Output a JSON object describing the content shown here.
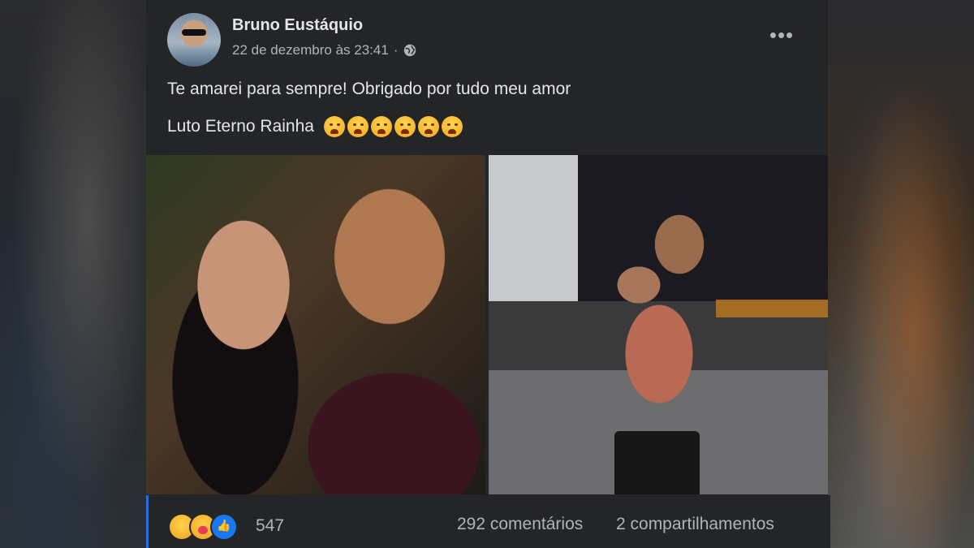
{
  "post": {
    "author": "Bruno Eustáquio",
    "timestamp": "22 de dezembro às 23:41",
    "separator": "·",
    "privacy_icon": "globe-icon",
    "more_label": "•••",
    "text_line1": "Te amarei para sempre! Obrigado por tudo meu amor",
    "text_line2": "Luto Eterno Rainha",
    "emoji_count": 6,
    "emoji_icon": "crying-face-icon"
  },
  "footer": {
    "reaction_icons": [
      "sad-reaction-icon",
      "care-reaction-icon",
      "like-reaction-icon"
    ],
    "reaction_count": "547",
    "comments": "292 comentários",
    "shares": "2 compartilhamentos"
  },
  "colors": {
    "card_bg": "#242526",
    "primary_text": "#e4e6eb",
    "secondary_text": "#b0b3b8",
    "like_blue": "#1877f2"
  }
}
